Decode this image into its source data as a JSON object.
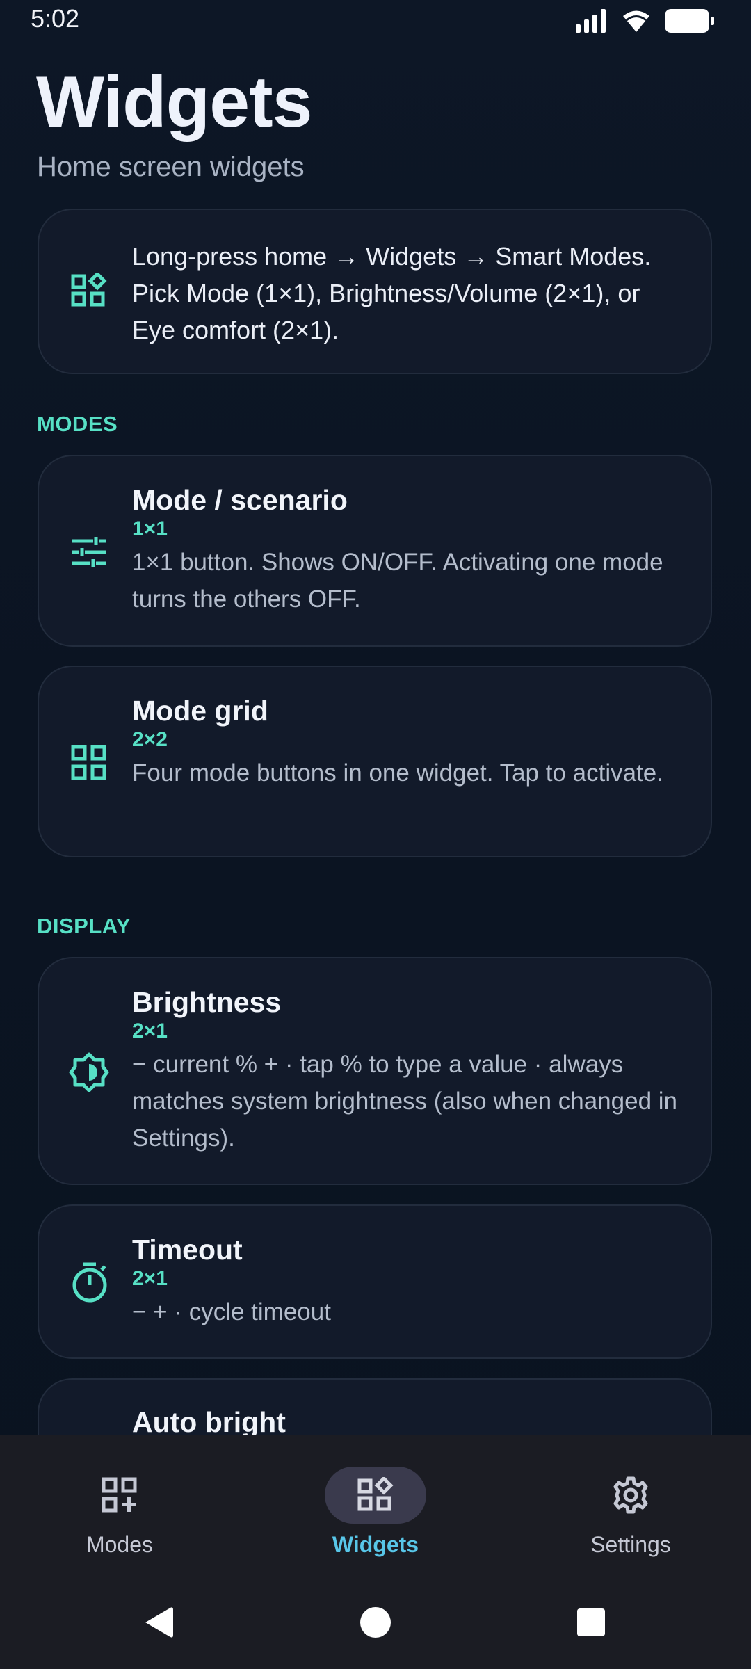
{
  "status_bar": {
    "time": "5:02"
  },
  "header": {
    "title": "Widgets",
    "subtitle": "Home screen widgets"
  },
  "info_card": {
    "icon": "widgets-icon",
    "text": "Long-press home → Widgets → Smart Modes. Pick Mode (1×1), Brightness/Volume (2×1), or Eye comfort (2×1)."
  },
  "sections": {
    "modes": {
      "label": "MODES",
      "items": [
        {
          "icon": "tune-icon",
          "title": "Mode / scenario",
          "size": "1×1",
          "description": "1×1 button. Shows ON/OFF. Activating one mode turns the others OFF."
        },
        {
          "icon": "grid-icon",
          "title": "Mode grid",
          "size": "2×2",
          "description": "Four mode buttons in one widget. Tap to activate."
        }
      ]
    },
    "display": {
      "label": "DISPLAY",
      "items": [
        {
          "icon": "brightness-icon",
          "title": "Brightness",
          "size": "2×1",
          "description": "−  current %  + · tap % to type a value · always matches system brightness (also when changed in Settings)."
        },
        {
          "icon": "timer-icon",
          "title": "Timeout",
          "size": "2×1",
          "description": "−  + · cycle timeout"
        },
        {
          "icon": "auto-brightness-icon",
          "title": "Auto bright",
          "size": "",
          "description": ""
        }
      ]
    }
  },
  "bottom_nav": {
    "items": [
      {
        "label": "Modes",
        "icon": "add-grid-icon",
        "active": false
      },
      {
        "label": "Widgets",
        "icon": "widgets-icon",
        "active": true
      },
      {
        "label": "Settings",
        "icon": "gear-icon",
        "active": false
      }
    ]
  },
  "colors": {
    "accent": "#57e0c5",
    "nav_active": "#58c6e8",
    "card_bg": "#121a2a",
    "background": "#0c1523"
  }
}
